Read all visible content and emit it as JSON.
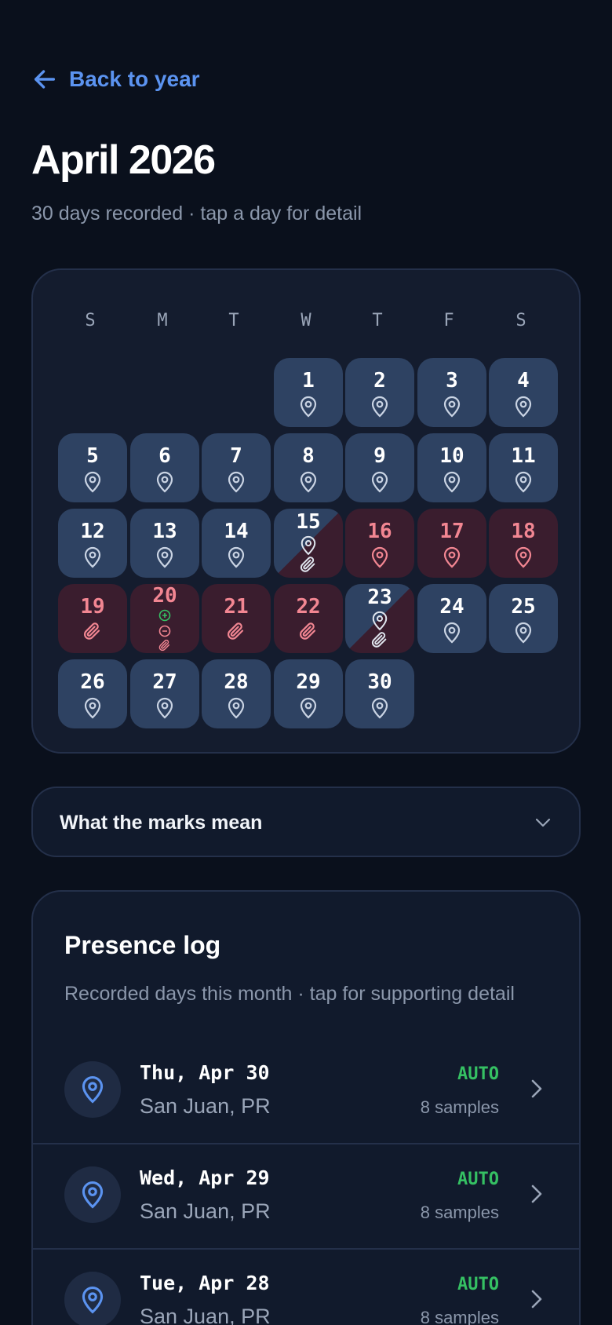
{
  "nav": {
    "back_label": "Back to year"
  },
  "header": {
    "title": "April 2026",
    "subtitle": "30 days recorded · tap a day for detail"
  },
  "calendar": {
    "weekdays": [
      "S",
      "M",
      "T",
      "W",
      "T",
      "F",
      "S"
    ],
    "days": [
      {
        "day": "1",
        "state": "located"
      },
      {
        "day": "2",
        "state": "located"
      },
      {
        "day": "3",
        "state": "located"
      },
      {
        "day": "4",
        "state": "located"
      },
      {
        "day": "5",
        "state": "located"
      },
      {
        "day": "6",
        "state": "located"
      },
      {
        "day": "7",
        "state": "located"
      },
      {
        "day": "8",
        "state": "located"
      },
      {
        "day": "9",
        "state": "located"
      },
      {
        "day": "10",
        "state": "located"
      },
      {
        "day": "11",
        "state": "located"
      },
      {
        "day": "12",
        "state": "located"
      },
      {
        "day": "13",
        "state": "located"
      },
      {
        "day": "14",
        "state": "located"
      },
      {
        "day": "15",
        "state": "located-attached"
      },
      {
        "day": "16",
        "state": "away"
      },
      {
        "day": "17",
        "state": "away"
      },
      {
        "day": "18",
        "state": "away"
      },
      {
        "day": "19",
        "state": "away-attached"
      },
      {
        "day": "20",
        "state": "mixed"
      },
      {
        "day": "21",
        "state": "away-attached"
      },
      {
        "day": "22",
        "state": "away-attached"
      },
      {
        "day": "23",
        "state": "located-attached"
      },
      {
        "day": "24",
        "state": "located"
      },
      {
        "day": "25",
        "state": "located"
      },
      {
        "day": "26",
        "state": "located"
      },
      {
        "day": "27",
        "state": "located"
      },
      {
        "day": "28",
        "state": "located"
      },
      {
        "day": "29",
        "state": "located"
      },
      {
        "day": "30",
        "state": "located"
      }
    ]
  },
  "legend": {
    "label": "What the marks mean",
    "icon": "chevron-down-icon"
  },
  "log": {
    "title": "Presence log",
    "subtitle": "Recorded days this month · tap for supporting detail",
    "entries": [
      {
        "date": "Thu, Apr 30",
        "place": "San Juan, PR",
        "badge": "AUTO",
        "samples": "8 samples"
      },
      {
        "date": "Wed, Apr 29",
        "place": "San Juan, PR",
        "badge": "AUTO",
        "samples": "8 samples"
      },
      {
        "date": "Tue, Apr 28",
        "place": "San Juan, PR",
        "badge": "AUTO",
        "samples": "8 samples"
      }
    ]
  },
  "colors": {
    "background": "#0a101c",
    "accent": "#5b93f0",
    "located_day": "#2e4262",
    "away_day": "#3a1d2e",
    "away_text": "#f28692",
    "auto_badge": "#35c063"
  }
}
